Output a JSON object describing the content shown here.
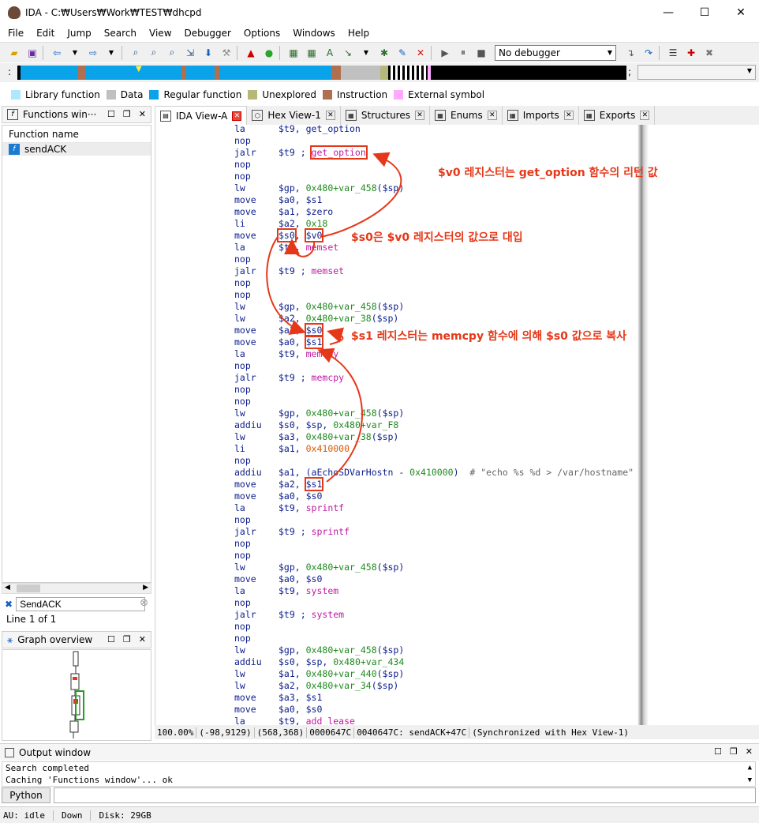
{
  "window": {
    "title": "IDA - C:₩Users₩Work₩TEST₩dhcpd",
    "minimize": "—",
    "maximize": "☐",
    "close": "✕"
  },
  "menu": [
    "File",
    "Edit",
    "Jump",
    "Search",
    "View",
    "Debugger",
    "Options",
    "Windows",
    "Help"
  ],
  "toolbar": {
    "debugger_value": "No debugger"
  },
  "legend": [
    {
      "label": "Library function",
      "color": "#aee8ff"
    },
    {
      "label": "Data",
      "color": "#c0c0c0"
    },
    {
      "label": "Regular function",
      "color": "#0aa2e8"
    },
    {
      "label": "Unexplored",
      "color": "#b8b77a"
    },
    {
      "label": "Instruction",
      "color": "#b07050"
    },
    {
      "label": "External symbol",
      "color": "#ffaaff"
    }
  ],
  "functions_panel": {
    "title": "Functions win···",
    "column": "Function name",
    "items": [
      "sendACK"
    ],
    "filter_value": "SendACK",
    "line_info": "Line 1 of 1"
  },
  "graph_panel": {
    "title": "Graph overview"
  },
  "tabs": [
    {
      "label": "IDA View-A",
      "icon": "▤"
    },
    {
      "label": "Hex View-1",
      "icon": "⬡"
    },
    {
      "label": "Structures",
      "icon": "▦"
    },
    {
      "label": "Enums",
      "icon": "▦"
    },
    {
      "label": "Imports",
      "icon": "▦"
    },
    {
      "label": "Exports",
      "icon": "▦"
    }
  ],
  "code": [
    {
      "op": "la",
      "args": [
        [
          "$t9, ",
          ""
        ],
        [
          "get_option",
          ""
        ]
      ]
    },
    {
      "op": "nop",
      "args": []
    },
    {
      "op": "jalr",
      "args": [
        [
          "$t9 ; ",
          ""
        ],
        [
          "get_option",
          "m boxed"
        ]
      ]
    },
    {
      "op": "nop",
      "args": []
    },
    {
      "op": "nop",
      "args": []
    },
    {
      "op": "lw",
      "args": [
        [
          "$gp, ",
          ""
        ],
        [
          "0x480+var_458",
          "g"
        ],
        [
          "($sp)",
          ""
        ]
      ]
    },
    {
      "op": "move",
      "args": [
        [
          "$a0, $s1",
          ""
        ]
      ]
    },
    {
      "op": "move",
      "args": [
        [
          "$a1, $zero",
          ""
        ]
      ]
    },
    {
      "op": "li",
      "args": [
        [
          "$a2, ",
          ""
        ],
        [
          "0x18",
          "g"
        ]
      ]
    },
    {
      "op": "move",
      "args": [
        [
          "$s0",
          "boxed"
        ],
        [
          ", ",
          ""
        ],
        [
          "$v0",
          "boxed"
        ]
      ]
    },
    {
      "op": "la",
      "args": [
        [
          "$t9, ",
          ""
        ],
        [
          "memset",
          "m"
        ]
      ]
    },
    {
      "op": "nop",
      "args": []
    },
    {
      "op": "jalr",
      "args": [
        [
          "$t9 ; ",
          ""
        ],
        [
          "memset",
          "m"
        ]
      ]
    },
    {
      "op": "nop",
      "args": []
    },
    {
      "op": "nop",
      "args": []
    },
    {
      "op": "lw",
      "args": [
        [
          "$gp, ",
          ""
        ],
        [
          "0x480+var_458",
          "g"
        ],
        [
          "($sp)",
          ""
        ]
      ]
    },
    {
      "op": "lw",
      "args": [
        [
          "$a2, ",
          ""
        ],
        [
          "0x480+var_38",
          "g"
        ],
        [
          "($sp)",
          ""
        ]
      ]
    },
    {
      "op": "move",
      "args": [
        [
          "$a1, ",
          ""
        ],
        [
          "$s0",
          "boxed"
        ]
      ]
    },
    {
      "op": "move",
      "args": [
        [
          "$a0, ",
          ""
        ],
        [
          "$s1",
          "boxed"
        ]
      ]
    },
    {
      "op": "la",
      "args": [
        [
          "$t9, ",
          ""
        ],
        [
          "memcpy",
          "m"
        ]
      ]
    },
    {
      "op": "nop",
      "args": []
    },
    {
      "op": "jalr",
      "args": [
        [
          "$t9 ; ",
          ""
        ],
        [
          "memcpy",
          "m"
        ]
      ]
    },
    {
      "op": "nop",
      "args": []
    },
    {
      "op": "nop",
      "args": []
    },
    {
      "op": "lw",
      "args": [
        [
          "$gp, ",
          ""
        ],
        [
          "0x480+var_458",
          "g"
        ],
        [
          "($sp)",
          ""
        ]
      ]
    },
    {
      "op": "addiu",
      "args": [
        [
          "$s0, $sp, ",
          ""
        ],
        [
          "0x480+var_F8",
          "g"
        ]
      ]
    },
    {
      "op": "lw",
      "args": [
        [
          "$a3, ",
          ""
        ],
        [
          "0x480+var_38",
          "g"
        ],
        [
          "($sp)",
          ""
        ]
      ]
    },
    {
      "op": "li",
      "args": [
        [
          "$a1, ",
          ""
        ],
        [
          "0x410000",
          "o"
        ]
      ]
    },
    {
      "op": "nop",
      "args": []
    },
    {
      "op": "addiu",
      "args": [
        [
          "$a1, (aEchoSDVarHostn - ",
          ""
        ],
        [
          "0x410000",
          "g"
        ],
        [
          ")  ",
          ""
        ],
        [
          "# \"echo %s %d > /var/hostname\"",
          "c"
        ]
      ]
    },
    {
      "op": "move",
      "args": [
        [
          "$a2, ",
          ""
        ],
        [
          "$s1",
          "boxed"
        ]
      ]
    },
    {
      "op": "move",
      "args": [
        [
          "$a0, $s0",
          ""
        ]
      ]
    },
    {
      "op": "la",
      "args": [
        [
          "$t9, ",
          ""
        ],
        [
          "sprintf",
          "m"
        ]
      ]
    },
    {
      "op": "nop",
      "args": []
    },
    {
      "op": "jalr",
      "args": [
        [
          "$t9 ; ",
          ""
        ],
        [
          "sprintf",
          "m"
        ]
      ]
    },
    {
      "op": "nop",
      "args": []
    },
    {
      "op": "nop",
      "args": []
    },
    {
      "op": "lw",
      "args": [
        [
          "$gp, ",
          ""
        ],
        [
          "0x480+var_458",
          "g"
        ],
        [
          "($sp)",
          ""
        ]
      ]
    },
    {
      "op": "move",
      "args": [
        [
          "$a0, $s0",
          ""
        ]
      ]
    },
    {
      "op": "la",
      "args": [
        [
          "$t9, ",
          ""
        ],
        [
          "system",
          "m"
        ]
      ]
    },
    {
      "op": "nop",
      "args": []
    },
    {
      "op": "jalr",
      "args": [
        [
          "$t9 ; ",
          ""
        ],
        [
          "system",
          "m"
        ]
      ]
    },
    {
      "op": "nop",
      "args": []
    },
    {
      "op": "nop",
      "args": []
    },
    {
      "op": "lw",
      "args": [
        [
          "$gp, ",
          ""
        ],
        [
          "0x480+var_458",
          "g"
        ],
        [
          "($sp)",
          ""
        ]
      ]
    },
    {
      "op": "addiu",
      "args": [
        [
          "$s0, $sp, ",
          ""
        ],
        [
          "0x480+var_434",
          "g"
        ]
      ]
    },
    {
      "op": "lw",
      "args": [
        [
          "$a1, ",
          ""
        ],
        [
          "0x480+var_440",
          "g"
        ],
        [
          "($sp)",
          ""
        ]
      ]
    },
    {
      "op": "lw",
      "args": [
        [
          "$a2, ",
          ""
        ],
        [
          "0x480+var_34",
          "g"
        ],
        [
          "($sp)",
          ""
        ]
      ]
    },
    {
      "op": "move",
      "args": [
        [
          "$a3, $s1",
          ""
        ]
      ]
    },
    {
      "op": "move",
      "args": [
        [
          "$a0, $s0",
          ""
        ]
      ]
    },
    {
      "op": "la",
      "args": [
        [
          "$t9, ",
          ""
        ],
        [
          "add_lease",
          "m"
        ]
      ]
    }
  ],
  "annotations": {
    "a1": "$v0 레지스터는 get_option 함수의 리턴 값",
    "a2": "$s0은 $v0 레지스터의 값으로 대입",
    "a3": "$s1 레지스터는 memcpy 함수에 의해 $s0 값으로 복사"
  },
  "status": {
    "zoom": "100.00%",
    "coords": "(-98,9129)",
    "pos": "(568,368)",
    "offset": "0000647C",
    "address": "0040647C: sendACK+47C",
    "sync": "(Synchronized with Hex View-1)"
  },
  "output": {
    "title": "Output window",
    "lines": [
      "Search completed",
      "Caching 'Functions window'... ok"
    ],
    "python_label": "Python"
  },
  "bottom": {
    "au": "AU:  idle",
    "dir": "Down",
    "disk": "Disk: 29GB"
  }
}
